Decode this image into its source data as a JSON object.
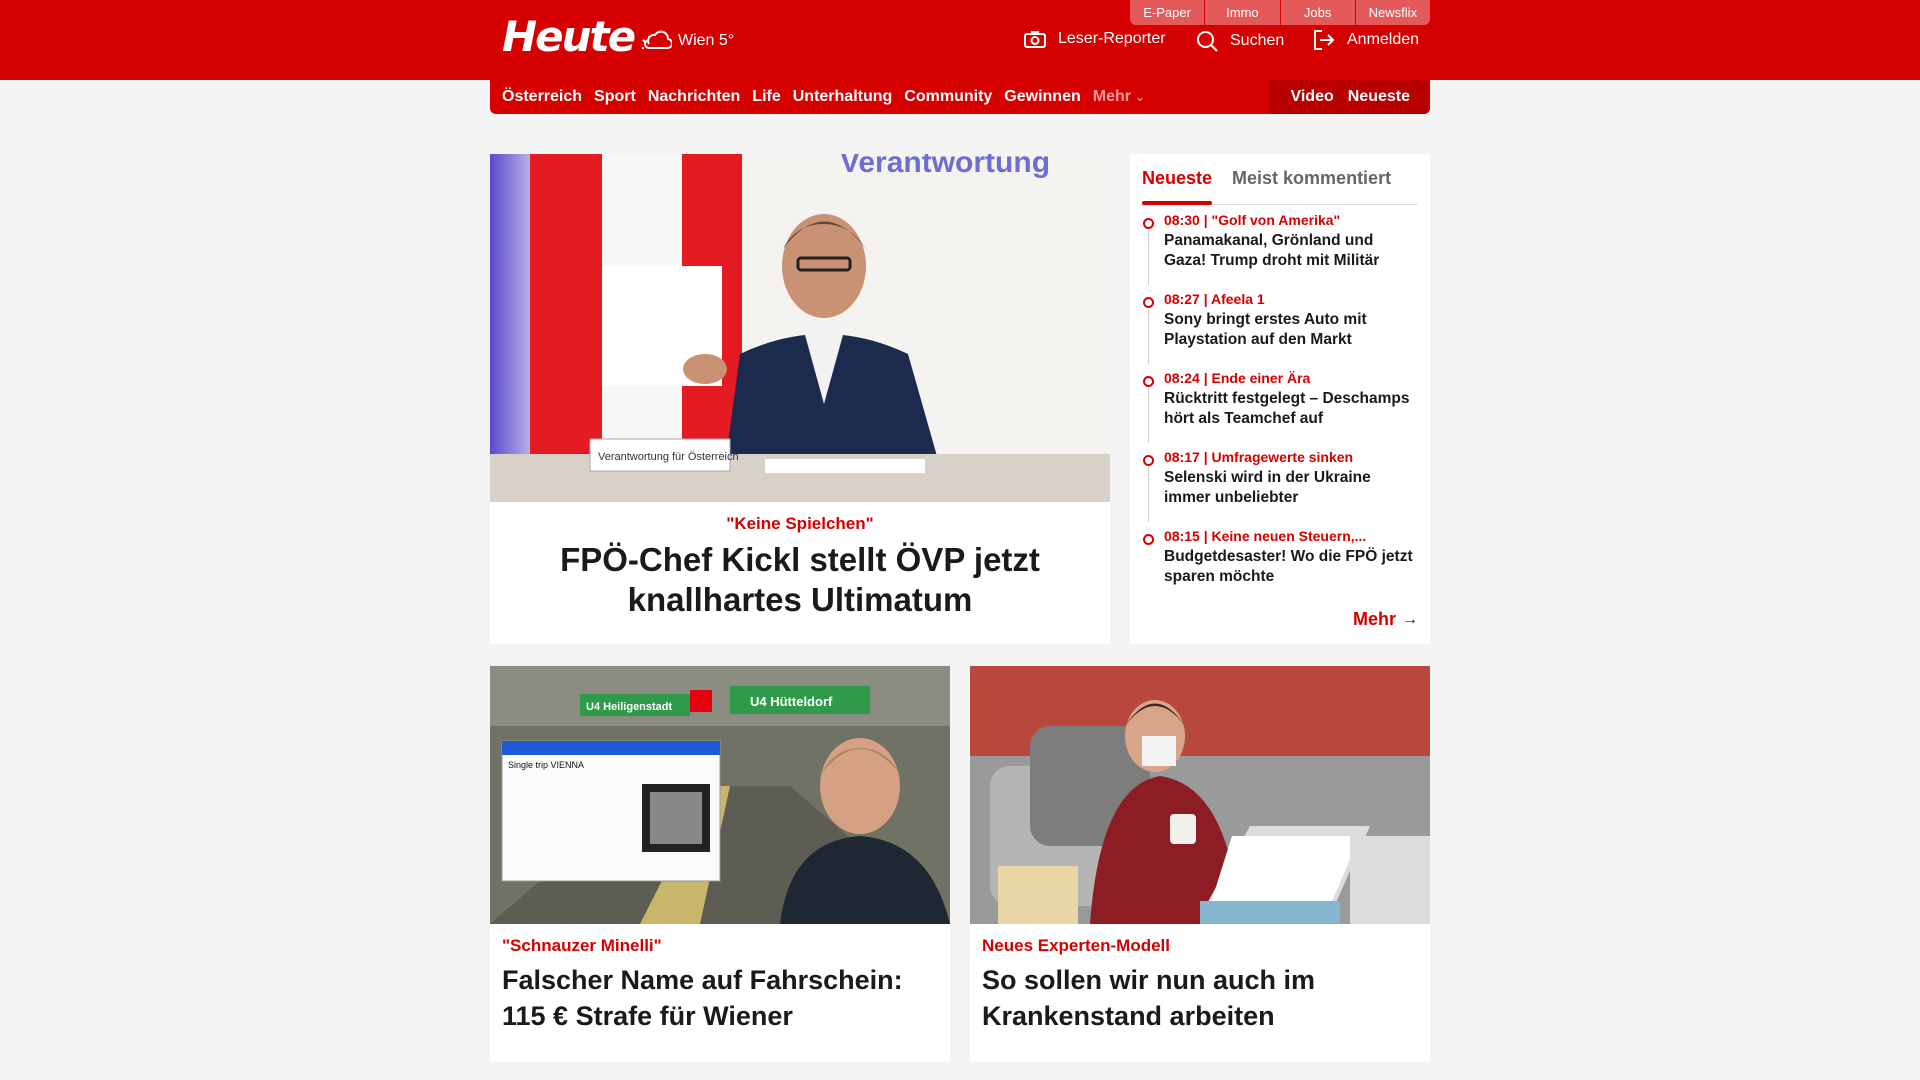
{
  "utility_links": [
    "E-Paper",
    "Immo",
    "Jobs",
    "Newsflix"
  ],
  "brand": {
    "logo": "Heute",
    "weather": "Wien 5°"
  },
  "header_actions": {
    "reporter": "Leser-Reporter",
    "search": "Suchen",
    "login": "Anmelden"
  },
  "nav": {
    "items": [
      "Österreich",
      "Sport",
      "Nachrichten",
      "Life",
      "Unterhaltung",
      "Community",
      "Gewinnen"
    ],
    "more": "Mehr",
    "right": [
      "Video",
      "Neueste"
    ]
  },
  "hero": {
    "kicker": "\"Keine Spielchen\"",
    "headline": "FPÖ-Chef Kickl stellt ÖVP jetzt knallhartes Ultimatum",
    "image_backdrop_text": "Verantwortung",
    "image_desk_sign": "Verantwortung für Österreich"
  },
  "sidebar": {
    "tabs": [
      "Neueste",
      "Meist kommentiert"
    ],
    "feed": [
      {
        "meta": "08:30 | \"Golf von Amerika\"",
        "title": "Panamakanal, Grönland und Gaza! Trump droht mit Militär"
      },
      {
        "meta": "08:27 | Afeela 1",
        "title": "Sony bringt erstes Auto mit Playstation auf den Markt"
      },
      {
        "meta": "08:24 | Ende einer Ära",
        "title": "Rücktritt festgelegt – Deschamps hört als Teamchef auf"
      },
      {
        "meta": "08:17 | Umfragewerte sinken",
        "title": "Selenski wird in der Ukraine immer unbeliebter"
      },
      {
        "meta": "08:15 | Keine neuen Steuern,...",
        "title": "Budgetdesaster! Wo die FPÖ jetzt sparen möchte"
      }
    ],
    "more": "Mehr"
  },
  "cards": [
    {
      "kicker": "\"Schnauzer Minelli\"",
      "headline": "Falscher Name auf Fahrschein: 115 € Strafe für Wiener",
      "sign_left": "U4 Heiligenstadt",
      "sign_right": "U4 Hütteldorf",
      "ticket_title": "Single trip VIENNA"
    },
    {
      "kicker": "Neues Experten-Modell",
      "headline": "So sollen wir nun auch im Krankenstand arbeiten"
    }
  ],
  "colors": {
    "brand_red": "#d50000",
    "background": "#f4f4f4"
  }
}
